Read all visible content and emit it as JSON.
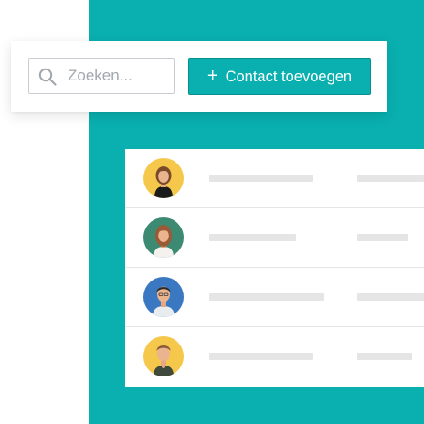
{
  "search": {
    "placeholder": "Zoeken...",
    "icon": "search-icon"
  },
  "toolbar": {
    "add_label": "Contact toevoegen",
    "add_icon": "plus-icon"
  },
  "colors": {
    "accent": "#0aafaf",
    "avatar_yellow": "#f5c84c",
    "avatar_green": "#3d8a72",
    "avatar_blue": "#3b78c2",
    "skeleton": "#e5e5e5"
  },
  "contacts": [
    {
      "avatar": "avatar-yellow"
    },
    {
      "avatar": "avatar-green"
    },
    {
      "avatar": "avatar-blue"
    },
    {
      "avatar": "avatar-yellow"
    }
  ]
}
